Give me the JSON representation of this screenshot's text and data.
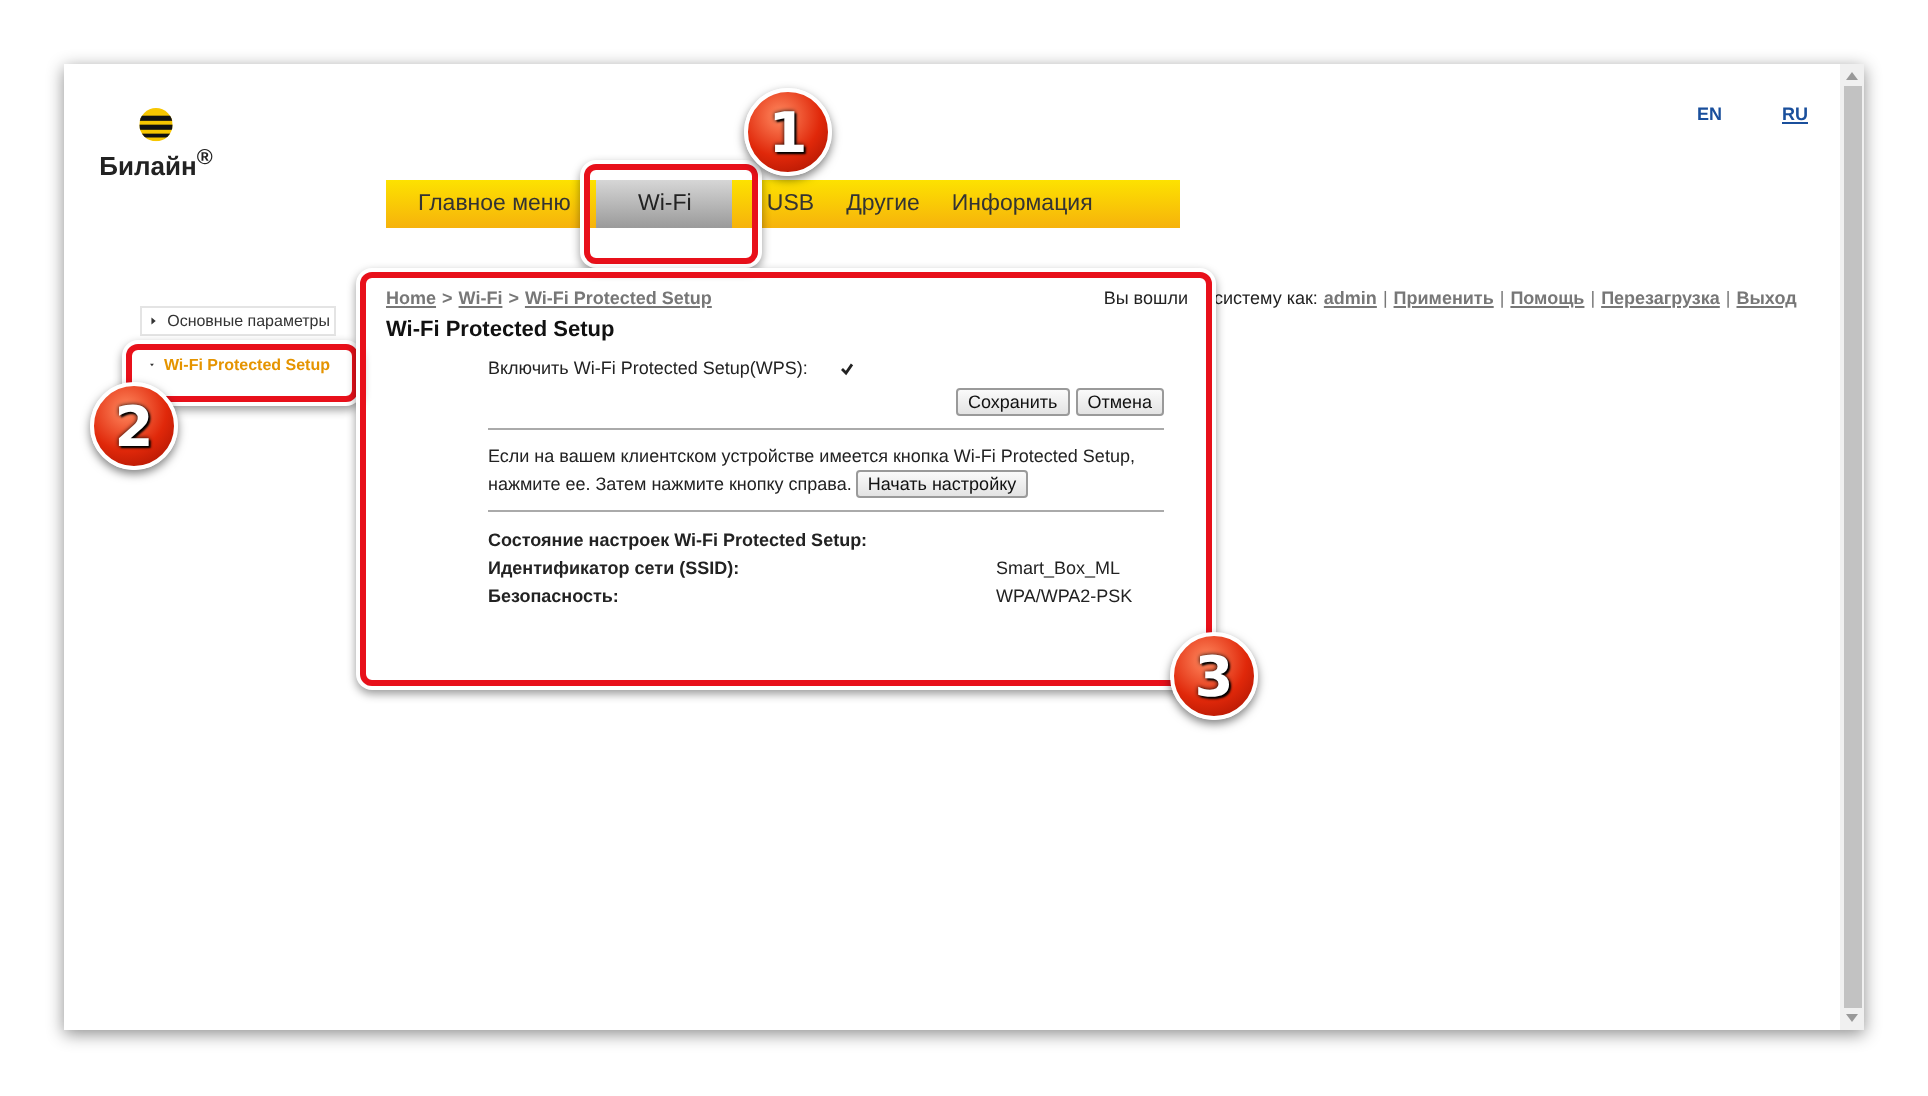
{
  "logo": {
    "text": "Билайн$^{®}$"
  },
  "languages": [
    {
      "label": "EN",
      "selected": true
    },
    {
      "label": "RU",
      "selected": false
    }
  ],
  "tabs": [
    {
      "label": "Главное меню",
      "selected": false
    },
    {
      "label": "Wi-Fi",
      "selected": true
    },
    {
      "label": "USB",
      "selected": false
    },
    {
      "label": "Другие",
      "selected": false
    },
    {
      "label": "Информация",
      "selected": false
    }
  ],
  "sidebar": {
    "items": [
      {
        "label": "Основные параметры",
        "selected": false,
        "expanded": false
      },
      {
        "label": "Wi-Fi Protected Setup",
        "selected": true,
        "expanded": true
      }
    ]
  },
  "breadcrumb": {
    "items": [
      "Home",
      "Wi-Fi",
      "Wi-Fi Protected Setup"
    ],
    "separator": ">"
  },
  "session": {
    "text_before": "Вы вошли",
    "text_after": "систему как:",
    "links": [
      "admin",
      "Применить",
      "Помощь",
      "Перезагрузка",
      "Выход"
    ],
    "separator": "|"
  },
  "panel": {
    "title": "Wi-Fi Protected Setup",
    "wps": {
      "label": "Включить Wi-Fi Protected Setup(WPS):",
      "checked": true
    },
    "buttons": [
      "Сохранить",
      "Отмена"
    ],
    "instruction_lines": [
      "Если на вашем клиентском устройстве имеется кнопка Wi-Fi Protected Setup,",
      "нажмите ее. Затем нажмите кнопку справа."
    ],
    "start_button": "Начать настройку",
    "status": [
      {
        "label": "Состояние настроек Wi-Fi Protected Setup:"
      },
      {
        "label": "Идентификатор сети (SSID):",
        "value": "Smart_Box_ML"
      },
      {
        "label": "Безопасность:",
        "value": "WPA/WPA2-PSK"
      }
    ]
  },
  "callouts": [
    {
      "number": "1"
    },
    {
      "number": "2"
    },
    {
      "number": "3"
    }
  ]
}
